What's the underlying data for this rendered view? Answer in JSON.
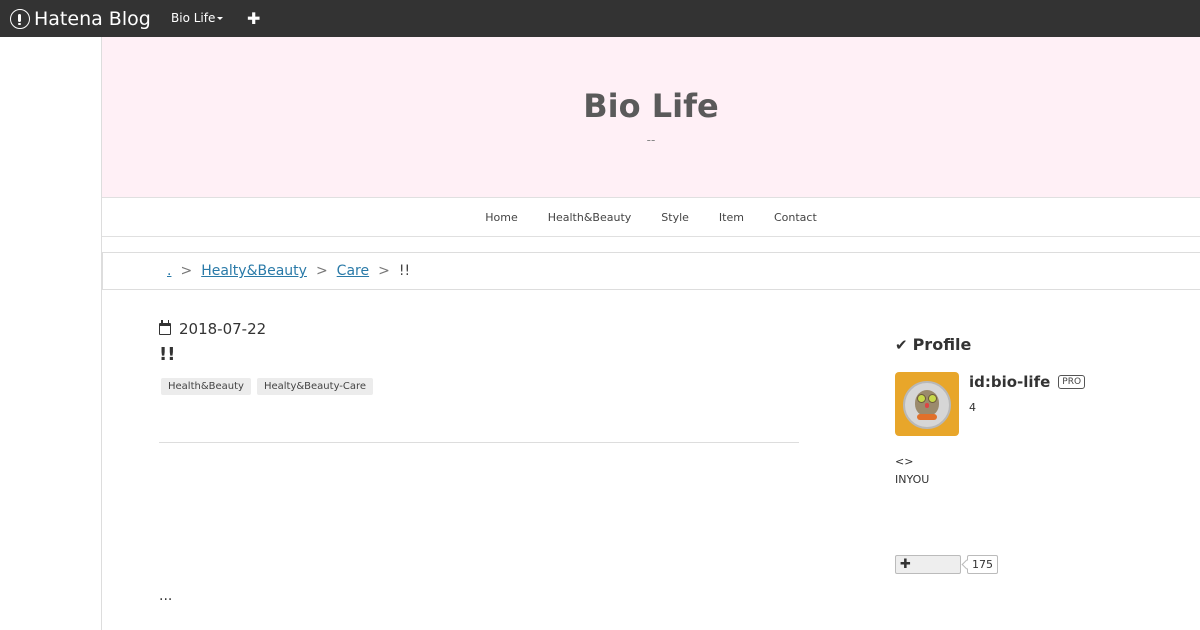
{
  "topbar": {
    "brand": "Hatena Blog",
    "blog_menu": "Bio Life",
    "plus": "✚"
  },
  "header": {
    "title": "Bio Life",
    "description": "--"
  },
  "nav": {
    "items": [
      "Home",
      "Health&Beauty",
      "Style",
      "Item",
      "Contact"
    ]
  },
  "breadcrumb": {
    "home": ".",
    "sep": ">",
    "level1": "Healty&Beauty",
    "level2": "Care",
    "current": "!!"
  },
  "entry": {
    "date": "2018-07-22",
    "title": "!!",
    "tags": [
      "Health&Beauty",
      "Healty&Beauty-Care"
    ],
    "more": "..."
  },
  "sidebar": {
    "profile_heading": "Profile",
    "user_id": "id:bio-life",
    "pro_badge": "PRO",
    "count": "4",
    "about_line1": "<>",
    "about_line2": "INYOU",
    "subscribe_icon": "✚",
    "subscribe_count": "175"
  }
}
